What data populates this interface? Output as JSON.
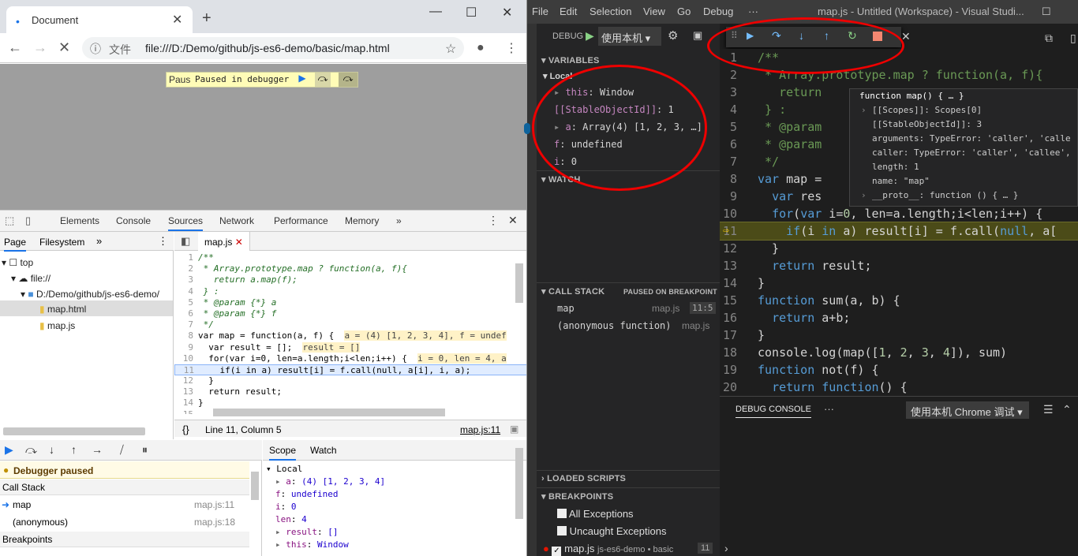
{
  "chrome": {
    "tab_title": "Document",
    "scheme_label": "文件",
    "url": "file:///D:/Demo/github/js-es6-demo/basic/map.html",
    "paused_label_partial": "Paus",
    "paused_label": "Paused in debugger"
  },
  "devtools": {
    "tabs": [
      "Elements",
      "Console",
      "Sources",
      "Network",
      "Performance",
      "Memory"
    ],
    "nav_tabs": [
      "Page",
      "Filesystem"
    ],
    "tree": {
      "top": "top",
      "file": "file://",
      "folder": "D:/Demo/github/js-es6-demo/",
      "file1": "map.html",
      "file2": "map.js"
    },
    "editor_tab": "map.js",
    "code": [
      {
        "n": "1",
        "t": "/**"
      },
      {
        "n": "2",
        "t": " * Array.prototype.map ? function(a, f){"
      },
      {
        "n": "3",
        "t": "   return a.map(f);"
      },
      {
        "n": "4",
        "t": " } :"
      },
      {
        "n": "5",
        "t": " * @param {*} a"
      },
      {
        "n": "6",
        "t": " * @param {*} f"
      },
      {
        "n": "7",
        "t": " */"
      },
      {
        "n": "8",
        "t": "var map = function(a, f) {"
      },
      {
        "n": "9",
        "t": "  var result = [];"
      },
      {
        "n": "10",
        "t": "  for(var i=0, len=a.length;i<len;i++) {"
      },
      {
        "n": "11",
        "t": "    if(i in a) result[i] = f.call(null, a[i], i, a);"
      },
      {
        "n": "12",
        "t": "  }"
      },
      {
        "n": "13",
        "t": "  return result;"
      },
      {
        "n": "14",
        "t": "}"
      },
      {
        "n": "15",
        "t": ""
      }
    ],
    "inline_values": {
      "l8": "a = (4) [1, 2, 3, 4], f = undef",
      "l9": "result = []",
      "l10": "i = 0, len = 4, a"
    },
    "status": "Line 11, Column 5",
    "status_link": "map.js:11",
    "paused_msg": "Debugger paused",
    "call_stack_title": "Call Stack",
    "call_stack": [
      {
        "fn": "map",
        "loc": "map.js:11"
      },
      {
        "fn": "(anonymous)",
        "loc": "map.js:18"
      }
    ],
    "breakpoints_title": "Breakpoints",
    "scope_tabs": [
      "Scope",
      "Watch"
    ],
    "scope_local": "Local",
    "scope_vars": [
      "a: (4) [1, 2, 3, 4]",
      "f: undefined",
      "i: 0",
      "len: 4",
      "result: []",
      "this: Window"
    ]
  },
  "vscode": {
    "menus": [
      "File",
      "Edit",
      "Selection",
      "View",
      "Go",
      "Debug",
      "···"
    ],
    "title": "map.js - Untitled (Workspace) - Visual Studi...",
    "debug_label": "DEBUG",
    "config": "使用本机",
    "variables_hdr": "VARIABLES",
    "local_hdr": "Local",
    "vars": [
      "this: Window",
      "[[StableObjectId]]: 1",
      "a: Array(4) [1, 2, 3, …]",
      "f: undefined",
      "i: 0"
    ],
    "watch_hdr": "WATCH",
    "callstack_hdr": "CALL STACK",
    "callstack_state": "PAUSED ON BREAKPOINT",
    "frames": [
      {
        "fn": "map",
        "file": "map.js",
        "pos": "11:5"
      },
      {
        "fn": "(anonymous function)",
        "file": "map.js"
      }
    ],
    "loaded_hdr": "LOADED SCRIPTS",
    "breakpoints_hdr": "BREAKPOINTS",
    "bp_all": "All Exceptions",
    "bp_uncaught": "Uncaught Exceptions",
    "bp_file": "map.js",
    "bp_path": "js-es6-demo • basic",
    "bp_line": "11",
    "code": [
      {
        "n": "1",
        "t": "/**"
      },
      {
        "n": "2",
        "t": " * Array.prototype.map ? function(a, f){"
      },
      {
        "n": "3",
        "t": "   return"
      },
      {
        "n": "4",
        "t": " } :"
      },
      {
        "n": "5",
        "t": " * @param"
      },
      {
        "n": "6",
        "t": " * @param"
      },
      {
        "n": "7",
        "t": " */"
      },
      {
        "n": "8",
        "t": "var map ="
      },
      {
        "n": "9",
        "t": "  var res"
      },
      {
        "n": "10",
        "t": "  for(var i=0, len=a.length;i<len;i++) {"
      },
      {
        "n": "11",
        "t": "    if(i in a) result[i] = f.call(null, a["
      },
      {
        "n": "12",
        "t": "  }"
      },
      {
        "n": "13",
        "t": "  return result;"
      },
      {
        "n": "14",
        "t": "}"
      },
      {
        "n": "15",
        "t": "function sum(a, b) {"
      },
      {
        "n": "16",
        "t": "  return a+b;"
      },
      {
        "n": "17",
        "t": "}"
      },
      {
        "n": "18",
        "t": "console.log(map([1, 2, 3, 4]), sum)"
      },
      {
        "n": "19",
        "t": "function not(f) {"
      },
      {
        "n": "20",
        "t": "  return function() {"
      }
    ],
    "hover": [
      "function map() { … }",
      "[[Scopes]]: Scopes[0]",
      "[[StableObjectId]]: 3",
      "arguments: TypeError: 'caller', 'calle",
      "caller: TypeError: 'caller', 'callee',",
      "length: 1",
      "name: \"map\"",
      "__proto__: function () { … }"
    ],
    "panel_tab": "DEBUG CONSOLE",
    "panel_more": "···",
    "panel_select": "使用本机 Chrome 调试"
  }
}
